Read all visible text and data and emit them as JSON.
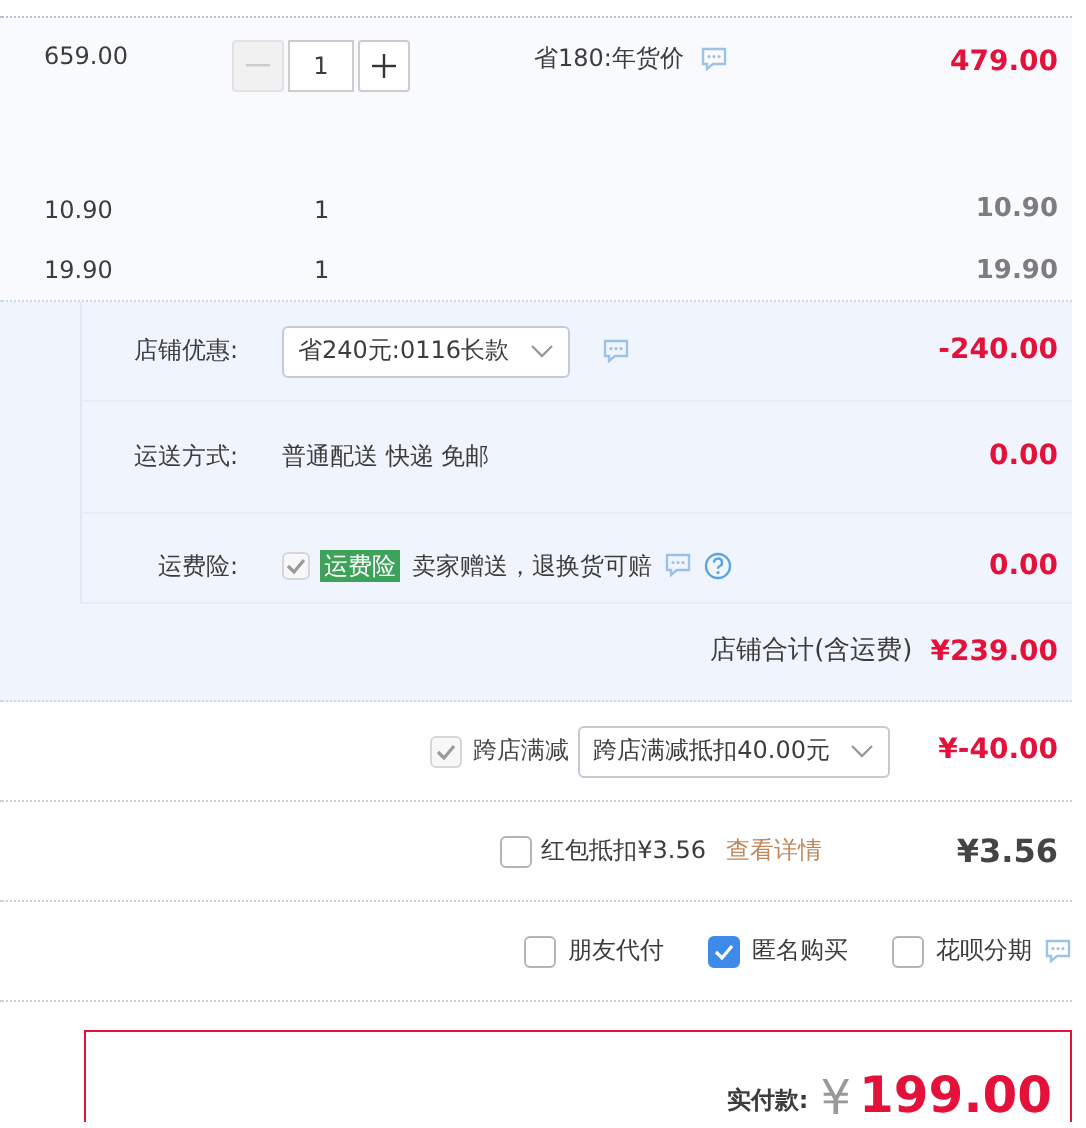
{
  "items": [
    {
      "kind": "stepper",
      "price": "659.00",
      "quantity": "1",
      "minus_disabled": true,
      "promo": "省180:年货价",
      "subtotal": "479.00",
      "discounted": true
    },
    {
      "kind": "plain",
      "price": "10.90",
      "quantity": "1",
      "subtotal": "10.90",
      "discounted": false
    },
    {
      "kind": "plain",
      "price": "19.90",
      "quantity": "1",
      "subtotal": "19.90",
      "discounted": false
    }
  ],
  "shop": {
    "rows": [
      {
        "kind": "select",
        "label": "店铺优惠:",
        "value": "省240元:0116长款",
        "amount": "-240.00"
      },
      {
        "kind": "text",
        "label": "运送方式:",
        "value": "普通配送 快递 免邮",
        "amount": "0.00"
      },
      {
        "kind": "insurance",
        "label": "运费险:",
        "checked": true,
        "disabled": true,
        "tag": "运费险",
        "value": "卖家赠送，退换货可赔",
        "amount": "0.00"
      }
    ],
    "total_label": "店铺合计(含运费)",
    "total": "¥239.00"
  },
  "cross_store": {
    "label": "跨店满减",
    "checked": true,
    "disabled": true,
    "value": "跨店满减抵扣40.00元",
    "amount": "¥-40.00"
  },
  "red_packet": {
    "label": "红包抵扣¥3.56",
    "checked": false,
    "link": "查看详情",
    "amount": "¥3.56"
  },
  "options": [
    {
      "label": "朋友代付",
      "checked": false,
      "help": false
    },
    {
      "label": "匿名购买",
      "checked": true,
      "help": false
    },
    {
      "label": "花呗分期",
      "checked": false,
      "help": true
    }
  ],
  "payment": {
    "label": "实付款:",
    "currency": "¥",
    "amount": "199.00"
  }
}
